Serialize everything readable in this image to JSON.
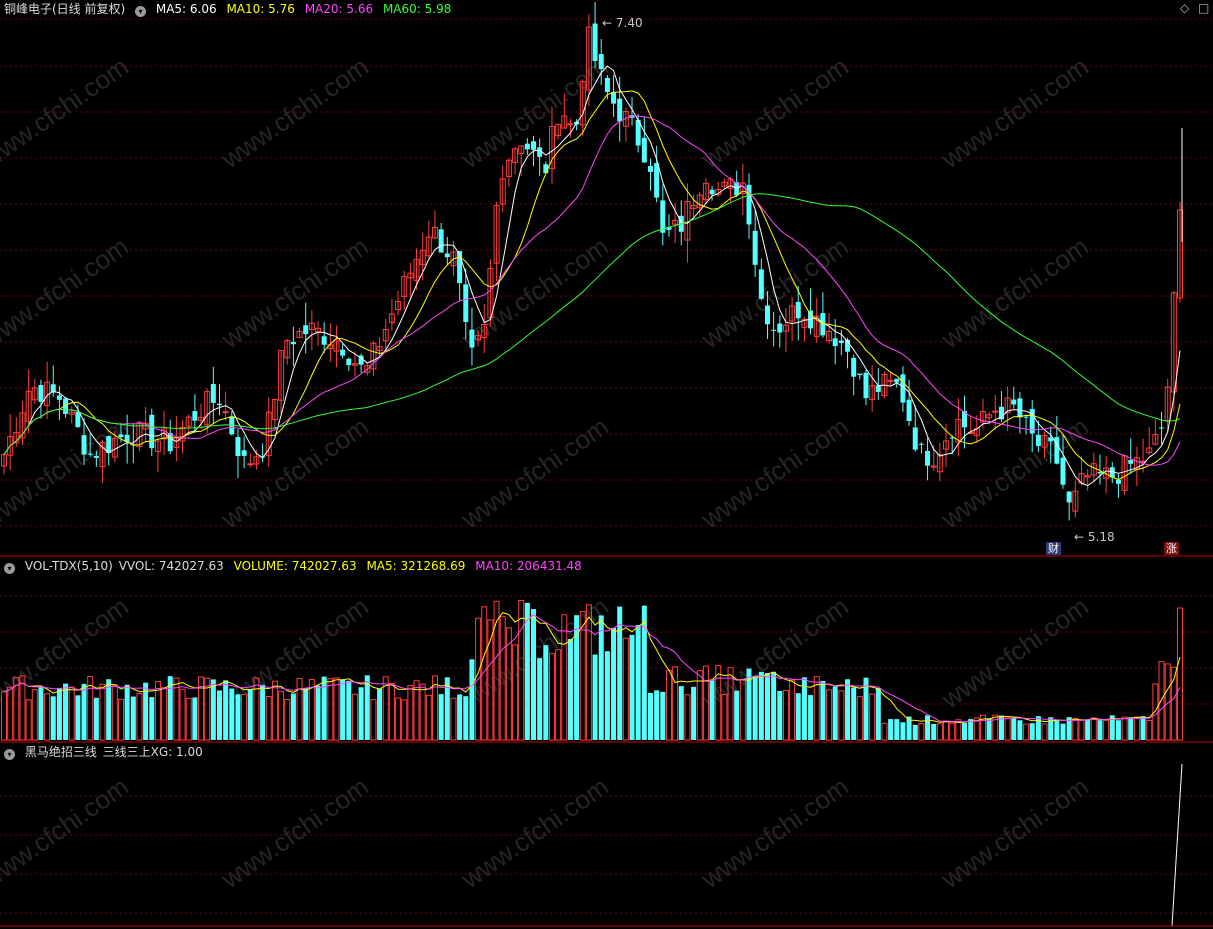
{
  "header": {
    "stock": "铜峰电子(日线 前复权)",
    "ma_labels": [
      {
        "label": "MA5: 6.06",
        "color": "#ffffff"
      },
      {
        "label": "MA10: 5.76",
        "color": "#ffff00"
      },
      {
        "label": "MA20: 5.66",
        "color": "#ff44ff"
      },
      {
        "label": "MA60: 5.98",
        "color": "#33ff33"
      }
    ],
    "diamond_icon": "◇",
    "square_icon": "□"
  },
  "volume_header": {
    "name": "VOL-TDX(5,10)",
    "vvol": "VVOL: 742027.63",
    "volume": "VOLUME: 742027.63",
    "ma5": "MA5: 321268.69",
    "ma10": "MA10: 206431.48"
  },
  "indicator_header": {
    "name": "黑马绝招三线",
    "value": "三线三上XG: 1.00"
  },
  "annotations": {
    "high": "7.40",
    "low": "5.18",
    "badge_cai": "财",
    "badge_zhang": "涨"
  },
  "watermark": "www.cfchi.com",
  "colors": {
    "up": "#ff3c3c",
    "down": "#54ffff",
    "ma5": "#ffffff",
    "ma10": "#ffff00",
    "ma20": "#ff44ff",
    "ma60": "#33ff33",
    "grid": "#7a0000",
    "divider": "#c00000"
  },
  "chart_data": {
    "type": "candlestick",
    "price_high": 7.4,
    "price_low": 5.18,
    "last_close_ma5": 6.06,
    "last_close_ma10": 5.76,
    "last_close_ma20": 5.66,
    "last_close_ma60": 5.98,
    "last_volume": 742027.63,
    "volume_ma5": 321268.69,
    "volume_ma10": 206431.48,
    "indicator_xg": 1.0
  }
}
